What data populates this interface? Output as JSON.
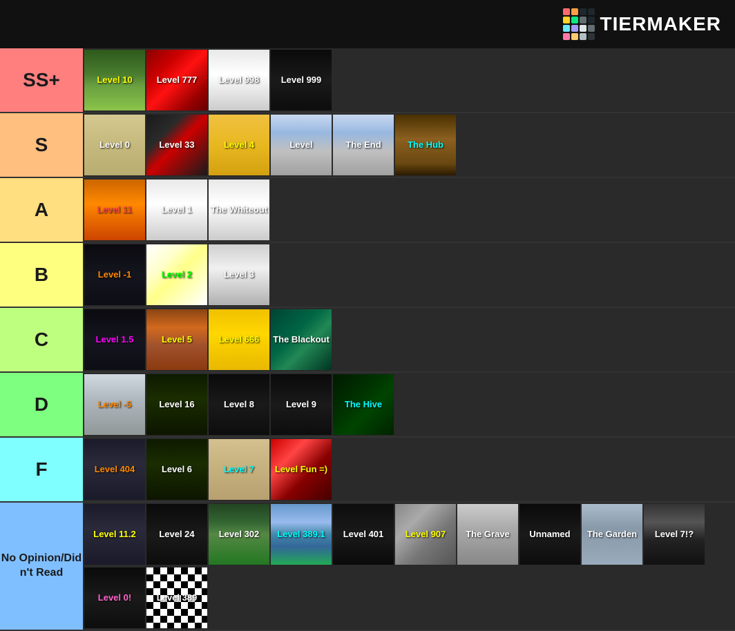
{
  "header": {
    "logo_text": "TiERMAKER"
  },
  "logo_colors": [
    "#ff6b6b",
    "#ff9f43",
    "#ffd32a",
    "#0be881",
    "#67e8f9",
    "#a29bfe",
    "#fd79a8",
    "#2d3436",
    "#636e72",
    "#b2bec3",
    "#dfe6e9",
    "#fdcb6e"
  ],
  "tiers": [
    {
      "id": "ss",
      "label": "SS+",
      "color": "#ff7f7f",
      "items": [
        {
          "label": "Level 10",
          "labelColor": "yellow",
          "bg": "bg-green-grass"
        },
        {
          "label": "Level 777",
          "labelColor": "white",
          "bg": "bg-red-casino"
        },
        {
          "label": "Level 998",
          "labelColor": "white",
          "bg": "bg-white-hall"
        },
        {
          "label": "Level 999",
          "labelColor": "white",
          "bg": "bg-dark-corridor"
        }
      ]
    },
    {
      "id": "s",
      "label": "S",
      "color": "#ffbf7f",
      "items": [
        {
          "label": "Level 0",
          "labelColor": "white",
          "bg": "bg-level0"
        },
        {
          "label": "Level 33",
          "labelColor": "white",
          "bg": "bg-level33"
        },
        {
          "label": "Level 4",
          "labelColor": "yellow",
          "bg": "bg-yellow-store"
        },
        {
          "label": "Level",
          "labelColor": "white",
          "bg": "bg-store-end"
        },
        {
          "label": "The End",
          "labelColor": "white",
          "bg": "bg-store-end"
        },
        {
          "label": "The Hub",
          "labelColor": "cyan",
          "bg": "bg-tunnel"
        }
      ]
    },
    {
      "id": "a",
      "label": "A",
      "color": "#ffdf7f",
      "items": [
        {
          "label": "Level 11",
          "labelColor": "red",
          "bg": "bg-orange-hall"
        },
        {
          "label": "Level 1",
          "labelColor": "white",
          "bg": "bg-white-hall"
        },
        {
          "label": "The Whiteout",
          "labelColor": "white",
          "bg": "bg-white-hall"
        }
      ]
    },
    {
      "id": "b",
      "label": "B",
      "color": "#ffff7f",
      "items": [
        {
          "label": "Level -1",
          "labelColor": "orange",
          "bg": "bg-dark-hall"
        },
        {
          "label": "Level 2",
          "labelColor": "green",
          "bg": "bg-bright-light"
        },
        {
          "label": "Level 3",
          "labelColor": "white",
          "bg": "bg-white-bars"
        }
      ]
    },
    {
      "id": "c",
      "label": "C",
      "color": "#bfff7f",
      "items": [
        {
          "label": "Level 1.5",
          "labelColor": "magenta",
          "bg": "bg-dark-hall"
        },
        {
          "label": "Level 5",
          "labelColor": "yellow",
          "bg": "bg-orange-wood"
        },
        {
          "label": "Level 666",
          "labelColor": "yellow",
          "bg": "bg-yellow-sign"
        },
        {
          "label": "The Blackout",
          "labelColor": "white",
          "bg": "bg-teal-nature"
        }
      ]
    },
    {
      "id": "d",
      "label": "D",
      "color": "#7fff7f",
      "items": [
        {
          "label": "Level -5",
          "labelColor": "orange",
          "bg": "bg-white-outdoor"
        },
        {
          "label": "Level 16",
          "labelColor": "white",
          "bg": "bg-dark-door"
        },
        {
          "label": "Level 8",
          "labelColor": "white",
          "bg": "bg-dark-corridor"
        },
        {
          "label": "Level 9",
          "labelColor": "white",
          "bg": "bg-dark-corridor"
        },
        {
          "label": "The Hive",
          "labelColor": "cyan",
          "bg": "bg-dark-green"
        }
      ]
    },
    {
      "id": "f",
      "label": "F",
      "color": "#7fffff",
      "items": [
        {
          "label": "Level 404",
          "labelColor": "orange",
          "bg": "bg-towers"
        },
        {
          "label": "Level 6",
          "labelColor": "white",
          "bg": "bg-dark-door"
        },
        {
          "label": "Level 7",
          "labelColor": "cyan",
          "bg": "bg-room-door"
        },
        {
          "label": "Level Fun =)",
          "labelColor": "yellow",
          "bg": "bg-fun-red"
        }
      ]
    },
    {
      "id": "no",
      "label": "No Opinion/Did n't Read",
      "color": "#7fbfff",
      "items": [
        {
          "label": "Level 11.2",
          "labelColor": "yellow",
          "bg": "bg-towers"
        },
        {
          "label": "Level 24",
          "labelColor": "white",
          "bg": "bg-dark-corridor"
        },
        {
          "label": "Level 302",
          "labelColor": "white",
          "bg": "bg-forest-302"
        },
        {
          "label": "Level 389.1",
          "labelColor": "cyan",
          "bg": "bg-mountain"
        },
        {
          "label": "Level 401",
          "labelColor": "white",
          "bg": "bg-dark-interior"
        },
        {
          "label": "Level 907",
          "labelColor": "yellow",
          "bg": "bg-industrial"
        },
        {
          "label": "The Grave",
          "labelColor": "white",
          "bg": "bg-figure"
        },
        {
          "label": "Unnamed",
          "labelColor": "white",
          "bg": "bg-dark-corridor"
        },
        {
          "label": "The Garden",
          "labelColor": "white",
          "bg": "bg-blue-gray"
        },
        {
          "label": "Level 7!?",
          "labelColor": "white",
          "bg": "bg-dark-machine"
        },
        {
          "label": "Level 0!",
          "labelColor": "pink",
          "bg": "bg-dark-corridor"
        },
        {
          "label": "Level 389",
          "labelColor": "white",
          "bg": "bg-checkered"
        }
      ]
    }
  ]
}
